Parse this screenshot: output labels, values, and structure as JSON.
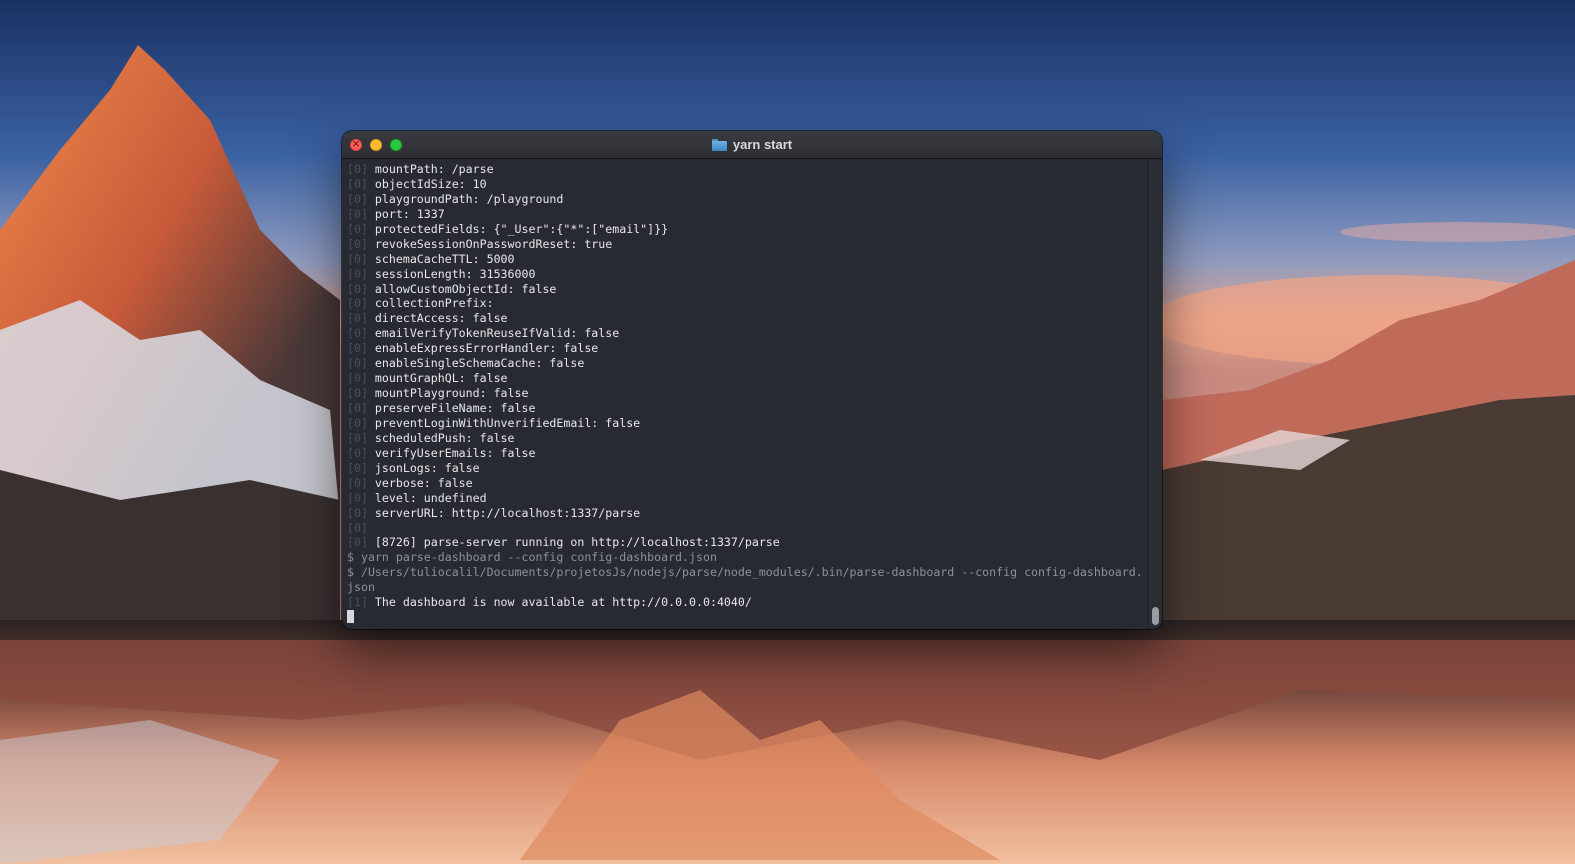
{
  "window": {
    "title": "yarn start",
    "icon": "folder-icon",
    "traffic_lights": [
      "close",
      "minimize",
      "zoom"
    ]
  },
  "colors": {
    "terminal_bg": "#282a33",
    "text": "#e8e8ea",
    "prefix": "#4b4e58",
    "command": "#8d9099",
    "close": "#fe5f57",
    "minimize": "#febc2e",
    "zoom": "#28c840"
  },
  "terminal": {
    "lines": [
      {
        "prefix": "[0] ",
        "text": "mountPath: /parse",
        "style": "out"
      },
      {
        "prefix": "[0] ",
        "text": "objectIdSize: 10",
        "style": "out"
      },
      {
        "prefix": "[0] ",
        "text": "playgroundPath: /playground",
        "style": "out"
      },
      {
        "prefix": "[0] ",
        "text": "port: 1337",
        "style": "out"
      },
      {
        "prefix": "[0] ",
        "text": "protectedFields: {\"_User\":{\"*\":[\"email\"]}}",
        "style": "out"
      },
      {
        "prefix": "[0] ",
        "text": "revokeSessionOnPasswordReset: true",
        "style": "out"
      },
      {
        "prefix": "[0] ",
        "text": "schemaCacheTTL: 5000",
        "style": "out"
      },
      {
        "prefix": "[0] ",
        "text": "sessionLength: 31536000",
        "style": "out"
      },
      {
        "prefix": "[0] ",
        "text": "allowCustomObjectId: false",
        "style": "out"
      },
      {
        "prefix": "[0] ",
        "text": "collectionPrefix:",
        "style": "out"
      },
      {
        "prefix": "[0] ",
        "text": "directAccess: false",
        "style": "out"
      },
      {
        "prefix": "[0] ",
        "text": "emailVerifyTokenReuseIfValid: false",
        "style": "out"
      },
      {
        "prefix": "[0] ",
        "text": "enableExpressErrorHandler: false",
        "style": "out"
      },
      {
        "prefix": "[0] ",
        "text": "enableSingleSchemaCache: false",
        "style": "out"
      },
      {
        "prefix": "[0] ",
        "text": "mountGraphQL: false",
        "style": "out"
      },
      {
        "prefix": "[0] ",
        "text": "mountPlayground: false",
        "style": "out"
      },
      {
        "prefix": "[0] ",
        "text": "preserveFileName: false",
        "style": "out"
      },
      {
        "prefix": "[0] ",
        "text": "preventLoginWithUnverifiedEmail: false",
        "style": "out"
      },
      {
        "prefix": "[0] ",
        "text": "scheduledPush: false",
        "style": "out"
      },
      {
        "prefix": "[0] ",
        "text": "verifyUserEmails: false",
        "style": "out"
      },
      {
        "prefix": "[0] ",
        "text": "jsonLogs: false",
        "style": "out"
      },
      {
        "prefix": "[0] ",
        "text": "verbose: false",
        "style": "out"
      },
      {
        "prefix": "[0] ",
        "text": "level: undefined",
        "style": "out"
      },
      {
        "prefix": "[0] ",
        "text": "serverURL: http://localhost:1337/parse",
        "style": "out"
      },
      {
        "prefix": "[0]",
        "text": "",
        "style": "out"
      },
      {
        "prefix": "[0] ",
        "text": "[8726] parse-server running on http://localhost:1337/parse",
        "style": "out"
      },
      {
        "prefix": "",
        "text": "$ yarn parse-dashboard --config config-dashboard.json",
        "style": "cmd"
      },
      {
        "prefix": "",
        "text": "$ /Users/tuliocalil/Documents/projetosJs/nodejs/parse/node_modules/.bin/parse-dashboard --config config-dashboard.",
        "style": "cmd"
      },
      {
        "prefix": "",
        "text": "json",
        "style": "cmd"
      },
      {
        "prefix": "[1] ",
        "text": "The dashboard is now available at http://0.0.0.0:4040/",
        "style": "out"
      }
    ]
  }
}
